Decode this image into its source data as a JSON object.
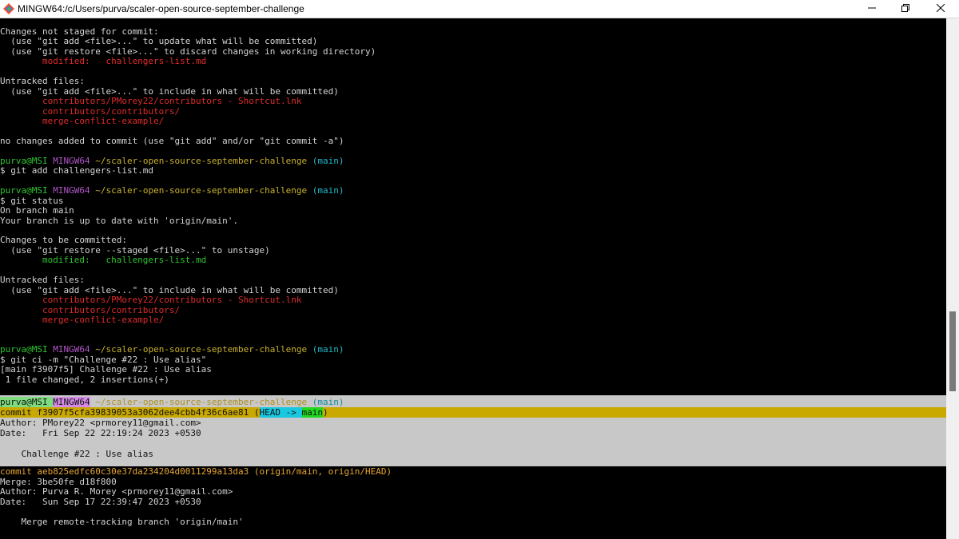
{
  "window": {
    "title": "MINGW64:/c/Users/purva/scaler-open-source-september-challenge"
  },
  "lines": [
    {
      "segs": [
        {
          "t": "Changes not staged for commit:",
          "c": "grey"
        }
      ]
    },
    {
      "segs": [
        {
          "t": "  (use \"git add <file>...\" to update what will be committed)",
          "c": "grey"
        }
      ]
    },
    {
      "segs": [
        {
          "t": "  (use \"git restore <file>...\" to discard changes in working directory)",
          "c": "grey"
        }
      ]
    },
    {
      "segs": [
        {
          "t": "        modified:   challengers-list.md",
          "c": "red"
        }
      ]
    },
    {
      "segs": [
        {
          "t": "",
          "c": "grey"
        }
      ]
    },
    {
      "segs": [
        {
          "t": "Untracked files:",
          "c": "grey"
        }
      ]
    },
    {
      "segs": [
        {
          "t": "  (use \"git add <file>...\" to include in what will be committed)",
          "c": "grey"
        }
      ]
    },
    {
      "segs": [
        {
          "t": "        contributors/PMorey22/contributors - Shortcut.lnk",
          "c": "red"
        }
      ]
    },
    {
      "segs": [
        {
          "t": "        contributors/contributors/",
          "c": "red"
        }
      ]
    },
    {
      "segs": [
        {
          "t": "        merge-conflict-example/",
          "c": "red"
        }
      ]
    },
    {
      "segs": [
        {
          "t": "",
          "c": "grey"
        }
      ]
    },
    {
      "segs": [
        {
          "t": "no changes added to commit (use \"git add\" and/or \"git commit -a\")",
          "c": "grey"
        }
      ]
    },
    {
      "segs": [
        {
          "t": "",
          "c": "grey"
        }
      ]
    },
    {
      "segs": [
        {
          "t": "purva@MSI ",
          "c": "green"
        },
        {
          "t": "MINGW64 ",
          "c": "magenta"
        },
        {
          "t": "~/scaler-open-source-september-challenge ",
          "c": "yellow"
        },
        {
          "t": "(main)",
          "c": "cyan"
        }
      ]
    },
    {
      "segs": [
        {
          "t": "$ git add challengers-list.md",
          "c": "grey"
        }
      ]
    },
    {
      "segs": [
        {
          "t": "",
          "c": "grey"
        }
      ]
    },
    {
      "segs": [
        {
          "t": "purva@MSI ",
          "c": "green"
        },
        {
          "t": "MINGW64 ",
          "c": "magenta"
        },
        {
          "t": "~/scaler-open-source-september-challenge ",
          "c": "yellow"
        },
        {
          "t": "(main)",
          "c": "cyan"
        }
      ]
    },
    {
      "segs": [
        {
          "t": "$ git status",
          "c": "grey"
        }
      ]
    },
    {
      "segs": [
        {
          "t": "On branch main",
          "c": "grey"
        }
      ]
    },
    {
      "segs": [
        {
          "t": "Your branch is up to date with 'origin/main'.",
          "c": "grey"
        }
      ]
    },
    {
      "segs": [
        {
          "t": "",
          "c": "grey"
        }
      ]
    },
    {
      "segs": [
        {
          "t": "Changes to be committed:",
          "c": "grey"
        }
      ]
    },
    {
      "segs": [
        {
          "t": "  (use \"git restore --staged <file>...\" to unstage)",
          "c": "grey"
        }
      ]
    },
    {
      "segs": [
        {
          "t": "        modified:   challengers-list.md",
          "c": "green"
        }
      ]
    },
    {
      "segs": [
        {
          "t": "",
          "c": "grey"
        }
      ]
    },
    {
      "segs": [
        {
          "t": "Untracked files:",
          "c": "grey"
        }
      ]
    },
    {
      "segs": [
        {
          "t": "  (use \"git add <file>...\" to include in what will be committed)",
          "c": "grey"
        }
      ]
    },
    {
      "segs": [
        {
          "t": "        contributors/PMorey22/contributors - Shortcut.lnk",
          "c": "red"
        }
      ]
    },
    {
      "segs": [
        {
          "t": "        contributors/contributors/",
          "c": "red"
        }
      ]
    },
    {
      "segs": [
        {
          "t": "        merge-conflict-example/",
          "c": "red"
        }
      ]
    },
    {
      "segs": [
        {
          "t": "",
          "c": "grey"
        }
      ]
    },
    {
      "segs": [
        {
          "t": "",
          "c": "grey"
        }
      ]
    },
    {
      "segs": [
        {
          "t": "purva@MSI ",
          "c": "green"
        },
        {
          "t": "MINGW64 ",
          "c": "magenta"
        },
        {
          "t": "~/scaler-open-source-september-challenge ",
          "c": "yellow"
        },
        {
          "t": "(main)",
          "c": "cyan"
        }
      ]
    },
    {
      "segs": [
        {
          "t": "$ git ci -m \"Challenge #22 : Use alias\"",
          "c": "grey"
        }
      ]
    },
    {
      "segs": [
        {
          "t": "[main f3907f5] Challenge #22 : Use alias",
          "c": "grey"
        }
      ]
    },
    {
      "segs": [
        {
          "t": " 1 file changed, 2 insertions(+)",
          "c": "grey"
        }
      ]
    },
    {
      "segs": [
        {
          "t": "",
          "c": "grey"
        }
      ]
    }
  ],
  "highlight": {
    "prompt": {
      "user": "purva@MSI",
      "host": "MINGW64",
      "path": "~/scaler-open-source-september-challenge",
      "branch": "(main)"
    },
    "commit_prefix": "commit f3907f5cfa39839053a3062dee4cbb4f36c6ae81 (",
    "head_tag": "HEAD -> ",
    "main_tag": "main",
    "commit_suffix": ")",
    "author": "Author: PMorey22 <prmorey11@gmail.com>",
    "date": "Date:   Fri Sep 22 22:19:24 2023 +0530",
    "blank": "",
    "message": "    Challenge #22 : Use alias"
  },
  "tail": [
    {
      "segs": [
        {
          "t": "commit aeb825edfc60c30e37da234204d0011299a13da3 (origin/main, origin/HEAD)",
          "c": "orange"
        }
      ]
    },
    {
      "segs": [
        {
          "t": "Merge: 3be50fe d18f800",
          "c": "grey"
        }
      ]
    },
    {
      "segs": [
        {
          "t": "Author: Purva R. Morey <prmorey11@gmail.com>",
          "c": "grey"
        }
      ]
    },
    {
      "segs": [
        {
          "t": "Date:   Sun Sep 17 22:39:47 2023 +0530",
          "c": "grey"
        }
      ]
    },
    {
      "segs": [
        {
          "t": "",
          "c": "grey"
        }
      ]
    },
    {
      "segs": [
        {
          "t": "    Merge remote-tracking branch 'origin/main'",
          "c": "grey"
        }
      ]
    }
  ]
}
